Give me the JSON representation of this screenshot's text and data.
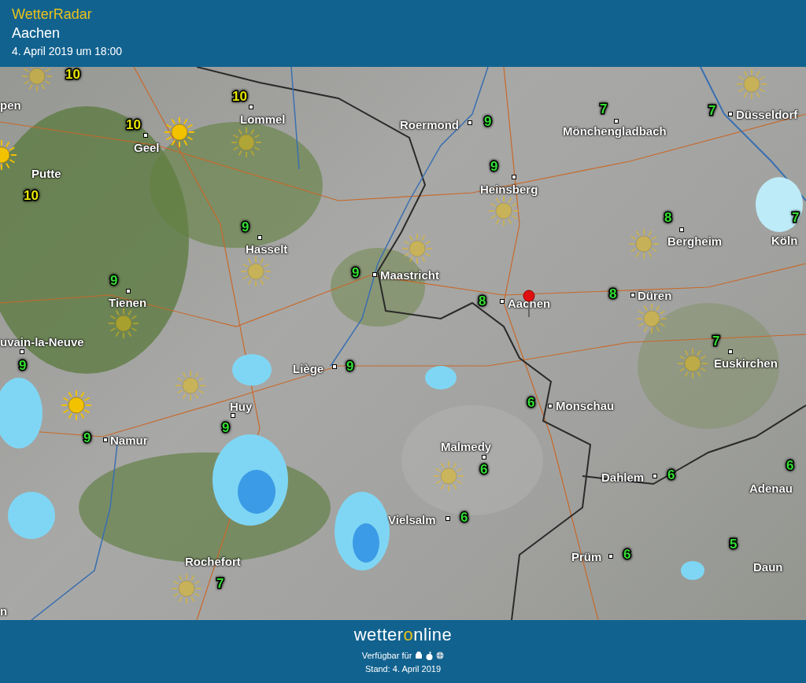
{
  "header": {
    "app_name": "WetterRadar",
    "location": "Aachen",
    "datetime": "4. April 2019 um 18:00"
  },
  "map": {
    "cities": [
      {
        "name": "Lommel",
        "temp": "10",
        "color": "#e6e600"
      },
      {
        "name": "Roermond",
        "temp": "9",
        "color": "#33dd33"
      },
      {
        "name": "Mönchengladbach",
        "temp": "7",
        "color": "#33dd33"
      },
      {
        "name": "Düsseldorf",
        "temp": "7",
        "color": "#33dd33"
      },
      {
        "name": "Geel",
        "temp": "10",
        "color": "#e6e600"
      },
      {
        "name": "Putte",
        "temp": "10",
        "color": "#e6e600"
      },
      {
        "name": "Heinsberg",
        "temp": "9",
        "color": "#33dd33"
      },
      {
        "name": "Hasselt",
        "temp": "9",
        "color": "#33dd33"
      },
      {
        "name": "Bergheim",
        "temp": "8",
        "color": "#33dd33"
      },
      {
        "name": "Köln",
        "temp": "7",
        "color": "#33dd33"
      },
      {
        "name": "Maastricht",
        "temp": "9",
        "color": "#33dd33"
      },
      {
        "name": "Tienen",
        "temp": "9",
        "color": "#33dd33"
      },
      {
        "name": "Aachen",
        "temp": "8",
        "color": "#33dd33"
      },
      {
        "name": "Düren",
        "temp": "8",
        "color": "#33dd33"
      },
      {
        "name": "uvain-la-Neuve",
        "temp": "9",
        "color": "#33dd33"
      },
      {
        "name": "Liège",
        "temp": "9",
        "color": "#33dd33"
      },
      {
        "name": "Euskirchen",
        "temp": "7",
        "color": "#33dd33"
      },
      {
        "name": "Huy",
        "temp": "9",
        "color": "#33dd33"
      },
      {
        "name": "Monschau",
        "temp": "6",
        "color": "#33dd33"
      },
      {
        "name": "Namur",
        "temp": "9",
        "color": "#33dd33"
      },
      {
        "name": "Malmedy",
        "temp": "6",
        "color": "#33dd33"
      },
      {
        "name": "Dahlem",
        "temp": "6",
        "color": "#33dd33"
      },
      {
        "name": "Adenau",
        "temp": "6",
        "color": "#33dd33"
      },
      {
        "name": "Vielsalm",
        "temp": "6",
        "color": "#33dd33"
      },
      {
        "name": "Rochefort",
        "temp": "7",
        "color": "#33dd33"
      },
      {
        "name": "Prüm",
        "temp": "6",
        "color": "#33dd33"
      },
      {
        "name": "Daun",
        "temp": "5",
        "color": "#33dd33"
      }
    ],
    "edge_labels": [
      {
        "text": "10",
        "kind": "temp",
        "color": "#e6e600"
      },
      {
        "text": "pen",
        "kind": "city"
      },
      {
        "text": "n",
        "kind": "city"
      }
    ]
  },
  "footer": {
    "logo": {
      "prefix": "wetter",
      "ring": "o",
      "suffix": "nline"
    },
    "availability": "Verfügbar für",
    "stand": "Stand: 4. April 2019"
  }
}
